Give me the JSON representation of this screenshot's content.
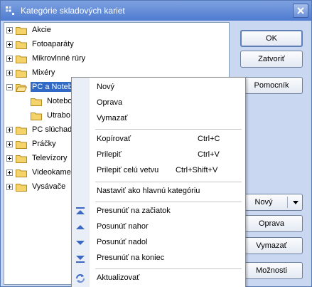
{
  "window": {
    "title": "Kategórie skladových kariet"
  },
  "tree": {
    "nodes": [
      {
        "label": "Akcie",
        "expander": "plus",
        "selected": false
      },
      {
        "label": "Fotoaparáty",
        "expander": "plus",
        "selected": false
      },
      {
        "label": "Mikrovlnné rúry",
        "expander": "plus",
        "selected": false
      },
      {
        "label": "Mixéry",
        "expander": "plus",
        "selected": false
      },
      {
        "label": "PC a Noteb",
        "expander": "minus",
        "selected": true
      },
      {
        "label": "Notebo",
        "expander": "none",
        "selected": false
      },
      {
        "label": "Utrabo",
        "expander": "none",
        "selected": false
      },
      {
        "label": "PC slúchad",
        "expander": "plus",
        "selected": false
      },
      {
        "label": "Práčky",
        "expander": "plus",
        "selected": false
      },
      {
        "label": "Televízory",
        "expander": "plus",
        "selected": false
      },
      {
        "label": "Videokame",
        "expander": "plus",
        "selected": false
      },
      {
        "label": "Vysávače",
        "expander": "plus",
        "selected": false
      }
    ]
  },
  "buttons": {
    "ok": "OK",
    "close": "Zatvoriť",
    "help": "Pomocník",
    "new": "Nový",
    "edit": "Oprava",
    "delete": "Vymazať",
    "options": "Možnosti"
  },
  "context_menu": {
    "items": [
      {
        "label": "Nový",
        "shortcut": ""
      },
      {
        "label": "Oprava",
        "shortcut": ""
      },
      {
        "label": "Vymazať",
        "shortcut": ""
      },
      {
        "label": "Kopírovať",
        "shortcut": "Ctrl+C"
      },
      {
        "label": "Prilepiť",
        "shortcut": "Ctrl+V"
      },
      {
        "label": "Prilepiť celú vetvu",
        "shortcut": "Ctrl+Shift+V"
      },
      {
        "label": "Nastaviť ako hlavnú kategóriu",
        "shortcut": ""
      },
      {
        "label": "Presunúť na začiatok",
        "shortcut": "",
        "icon": "move-to-top-icon"
      },
      {
        "label": "Posunúť nahor",
        "shortcut": "",
        "icon": "move-up-icon"
      },
      {
        "label": "Posunúť nadol",
        "shortcut": "",
        "icon": "move-down-icon"
      },
      {
        "label": "Presunúť na koniec",
        "shortcut": "",
        "icon": "move-to-bottom-icon"
      },
      {
        "label": "Aktualizovať",
        "shortcut": "",
        "icon": "refresh-icon"
      }
    ]
  },
  "colors": {
    "titlebar": "#4f7bd0",
    "selection": "#3169c6",
    "panel": "#c9d8f0",
    "folder": "#f5d36b"
  }
}
